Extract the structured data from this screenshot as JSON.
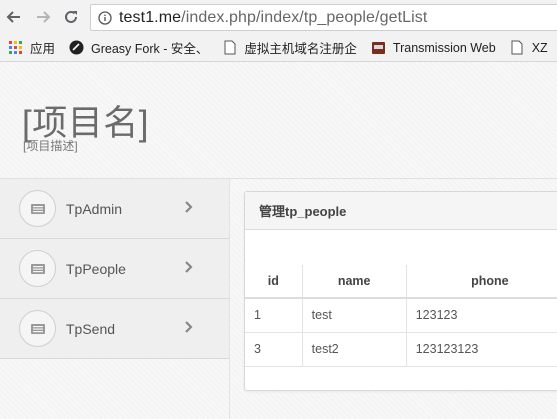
{
  "browser": {
    "url_host": "test1.me",
    "url_path": "/index.php/index/tp_people/getList",
    "bookmarks": [
      {
        "label": "应用",
        "icon": "apps-grid-icon"
      },
      {
        "label": "Greasy Fork - 安全、",
        "icon": "greasyfork-icon"
      },
      {
        "label": "虚拟主机域名注册企",
        "icon": "page-icon"
      },
      {
        "label": "Transmission Web",
        "icon": "transmission-icon"
      },
      {
        "label": "XZ",
        "icon": "page-icon"
      }
    ]
  },
  "header": {
    "project_name": "[项目名]",
    "project_desc": "[项目描述]"
  },
  "sidebar": {
    "items": [
      {
        "label": "TpAdmin",
        "icon": "list-icon"
      },
      {
        "label": "TpPeople",
        "icon": "list-icon"
      },
      {
        "label": "TpSend",
        "icon": "list-icon"
      }
    ]
  },
  "panel": {
    "title": "管理tp_people",
    "columns": [
      "id",
      "name",
      "phone"
    ],
    "rows": [
      [
        "1",
        "test",
        "123123"
      ],
      [
        "3",
        "test2",
        "123123123"
      ]
    ]
  }
}
